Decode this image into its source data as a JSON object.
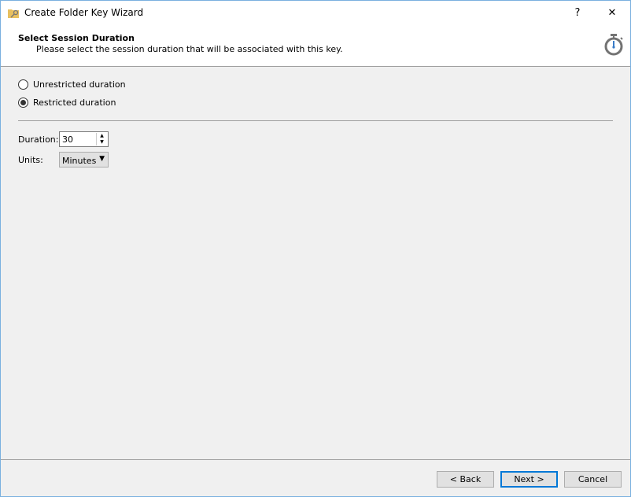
{
  "window": {
    "title": "Create Folder Key Wizard",
    "help": "?",
    "close": "✕"
  },
  "header": {
    "title": "Select Session Duration",
    "subtitle": "Please select the session duration that will be associated with this key.",
    "icon": "stopwatch-icon"
  },
  "options": [
    {
      "label": "Unrestricted duration",
      "selected": false
    },
    {
      "label": "Restricted duration",
      "selected": true
    }
  ],
  "duration": {
    "label": "Duration:",
    "value": "30"
  },
  "units": {
    "label": "Units:",
    "value": "Minutes"
  },
  "buttons": {
    "back": "< Back",
    "next": "Next >",
    "cancel": "Cancel"
  },
  "colors": {
    "accent": "#0078d7",
    "icon": "#737373",
    "icon_hand": "#3a7cc8"
  }
}
